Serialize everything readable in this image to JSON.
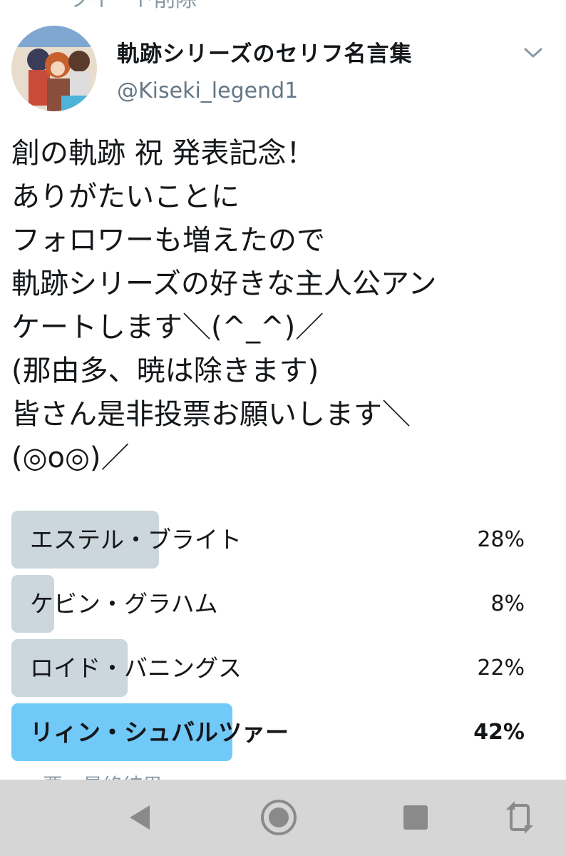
{
  "top_partial_text": "ツイート削除",
  "tweet": {
    "display_name": "軌跡シリーズのセリフ名言集",
    "handle": "@Kiseki_legend1",
    "text": "創の軌跡 祝 発表記念！\nありがたいことに\nフォロワーも増えたので\n軌跡シリーズの好きな主人公アン\nケートします＼(^_^)／\n(那由多、暁は除きます)\n皆さん是非投票お願いします＼\n(◎o◎)／"
  },
  "poll": {
    "options": [
      {
        "label": "エステル・ブライト",
        "percent_text": "28%",
        "percent": 28
      },
      {
        "label": "ケビン・グラハム",
        "percent_text": "8%",
        "percent": 8
      },
      {
        "label": "ロイド・バニングス",
        "percent_text": "22%",
        "percent": 22
      },
      {
        "label": "リィン・シュバルツァー",
        "percent_text": "42%",
        "percent": 42,
        "winner": true
      }
    ],
    "footer_partial": "票・最終結果"
  },
  "icons": {
    "caret": "chevron-down-icon",
    "nav_back": "back-triangle-icon",
    "nav_home": "home-circle-icon",
    "nav_recents": "recents-square-icon",
    "nav_rotate": "rotate-screen-icon"
  },
  "colors": {
    "bar": "#ccd6dd",
    "winner_bar": "#71c9f8",
    "secondary_text": "#657786",
    "navbar": "#d6d6d6"
  }
}
